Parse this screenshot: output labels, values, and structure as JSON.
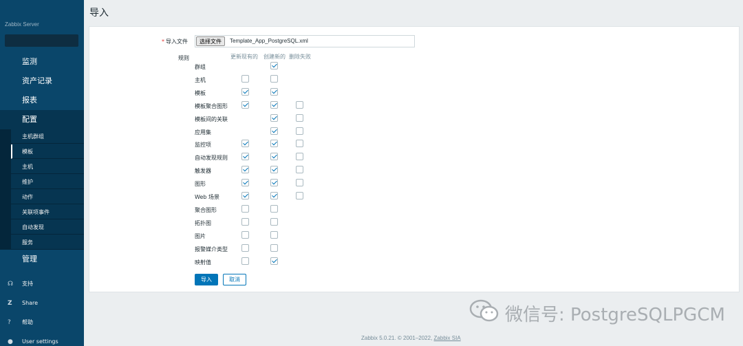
{
  "sidebar": {
    "brand": "Zabbix Server",
    "main_menu": [
      {
        "label": "监测"
      },
      {
        "label": "资产记录"
      },
      {
        "label": "报表"
      },
      {
        "label": "配置"
      },
      {
        "label": "管理"
      }
    ],
    "submenu": [
      {
        "label": "主机群组"
      },
      {
        "label": "模板"
      },
      {
        "label": "主机"
      },
      {
        "label": "维护"
      },
      {
        "label": "动作"
      },
      {
        "label": "关联项事件"
      },
      {
        "label": "自动发现"
      },
      {
        "label": "服务"
      }
    ],
    "footer": [
      {
        "label": "支持",
        "icon": "headset-icon"
      },
      {
        "label": "Share",
        "icon": "share-icon"
      },
      {
        "label": "帮助",
        "icon": "help-icon"
      },
      {
        "label": "User settings",
        "icon": "user-icon"
      }
    ]
  },
  "page": {
    "title": "导入"
  },
  "form": {
    "file_label": "导入文件",
    "required_mark": "*",
    "file_button": "选择文件",
    "file_name": "Template_App_PostgreSQL.xml",
    "rules_label": "规则",
    "columns": {
      "update": "更新现有的",
      "create": "创建新的",
      "delete": "删除失败"
    },
    "rules": [
      {
        "name": "群组",
        "update": null,
        "create": true,
        "delete": null
      },
      {
        "name": "主机",
        "update": false,
        "create": false,
        "delete": null
      },
      {
        "name": "模板",
        "update": true,
        "create": true,
        "delete": null
      },
      {
        "name": "模板聚合图形",
        "update": true,
        "create": true,
        "delete": false
      },
      {
        "name": "模板间的关联",
        "update": null,
        "create": true,
        "delete": false
      },
      {
        "name": "应用集",
        "update": null,
        "create": true,
        "delete": false
      },
      {
        "name": "监控项",
        "update": true,
        "create": true,
        "delete": false
      },
      {
        "name": "自动发现规则",
        "update": true,
        "create": true,
        "delete": false
      },
      {
        "name": "触发器",
        "update": true,
        "create": true,
        "delete": false
      },
      {
        "name": "图形",
        "update": true,
        "create": true,
        "delete": false
      },
      {
        "name": "Web 场景",
        "update": true,
        "create": true,
        "delete": false
      },
      {
        "name": "聚合图形",
        "update": false,
        "create": false,
        "delete": null
      },
      {
        "name": "拓扑图",
        "update": false,
        "create": false,
        "delete": null
      },
      {
        "name": "图片",
        "update": false,
        "create": false,
        "delete": null
      },
      {
        "name": "报警媒介类型",
        "update": false,
        "create": false,
        "delete": null
      },
      {
        "name": "映射值",
        "update": false,
        "create": true,
        "delete": null
      }
    ],
    "import_button": "导入",
    "cancel_button": "取消"
  },
  "footer": {
    "text": "Zabbix 5.0.21. © 2001–2022,",
    "link": "Zabbix SIA"
  },
  "watermark": {
    "text": "微信号: PostgreSQLPGCM"
  }
}
